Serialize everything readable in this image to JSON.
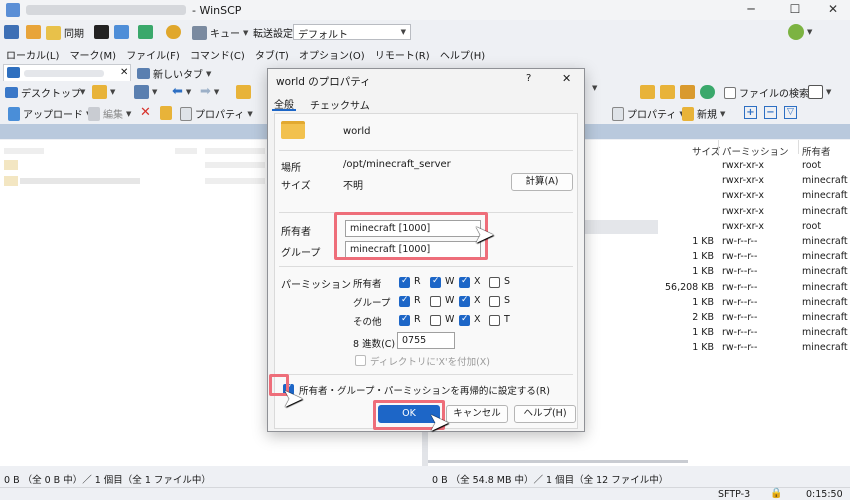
{
  "app": {
    "title": "- WinSCP",
    "window_buttons": {
      "minimize": "─",
      "maximize": "☐",
      "close": "✕"
    }
  },
  "toolbar1": {
    "sync_label": "同期",
    "queue_label": "キュー",
    "transfer_settings_label": "転送設定",
    "transfer_preset": "デフォルト"
  },
  "menu": [
    "ローカル(L)",
    "マーク(M)",
    "ファイル(F)",
    "コマンド(C)",
    "タブ(T)",
    "オプション(O)",
    "リモート(R)",
    "ヘルプ(H)"
  ],
  "tabs": {
    "new_tab": "新しいタブ"
  },
  "local_toolbar": {
    "location": "デスクトップ",
    "upload": "アップロード",
    "edit": "編集",
    "properties": "プロパティ"
  },
  "remote_toolbar": {
    "find_files": "ファイルの検索",
    "properties": "プロパティ",
    "new": "新規"
  },
  "remote_columns": {
    "size": "サイズ",
    "permissions": "パーミッション",
    "owner": "所有者"
  },
  "remote_rows": [
    {
      "size": "",
      "perm": "rwxr-xr-x",
      "owner": "root"
    },
    {
      "size": "",
      "perm": "rwxr-xr-x",
      "owner": "minecraft"
    },
    {
      "size": "",
      "perm": "rwxr-xr-x",
      "owner": "minecraft"
    },
    {
      "size": "",
      "perm": "rwxr-xr-x",
      "owner": "minecraft"
    },
    {
      "size": "",
      "perm": "rwxr-xr-x",
      "owner": "root"
    },
    {
      "size": "1 KB",
      "perm": "rw-r--r--",
      "owner": "minecraft"
    },
    {
      "size": "1 KB",
      "perm": "rw-r--r--",
      "owner": "minecraft"
    },
    {
      "size": "1 KB",
      "perm": "rw-r--r--",
      "owner": "minecraft"
    },
    {
      "size": "56,208 KB",
      "perm": "rw-r--r--",
      "owner": "minecraft"
    },
    {
      "size": "1 KB",
      "perm": "rw-r--r--",
      "owner": "minecraft"
    },
    {
      "size": "2 KB",
      "perm": "rw-r--r--",
      "owner": "minecraft"
    },
    {
      "size": "1 KB",
      "perm": "rw-r--r--",
      "owner": "minecraft"
    },
    {
      "size": "1 KB",
      "perm": "rw-r--r--",
      "owner": "minecraft"
    }
  ],
  "status": {
    "local": "0 B （全 0 B 中）／ 1 個目（全 1 ファイル中）",
    "remote": "0 B （全 54.8 MB 中）／ 1 個目（全 12 ファイル中）",
    "protocol": "SFTP-3",
    "time": "0:15:50"
  },
  "dialog": {
    "title": "world のプロパティ",
    "help": "?",
    "close": "✕",
    "tab_general": "全般",
    "tab_checksum": "チェックサム",
    "name": "world",
    "location_label": "場所",
    "location_value": "/opt/minecraft_server",
    "size_label": "サイズ",
    "size_value": "不明",
    "calc_button": "計算(A)",
    "owner_label": "所有者",
    "owner_value": "minecraft [1000]",
    "group_label": "グループ",
    "group_value": "minecraft [1000]",
    "perm_label": "パーミッション",
    "perm_rows": [
      {
        "label": "所有者",
        "r": "R",
        "w": "W",
        "x": "X",
        "s": "S"
      },
      {
        "label": "グループ",
        "r": "R",
        "w": "W",
        "x": "X",
        "s": "S"
      },
      {
        "label": "その他",
        "r": "R",
        "w": "W",
        "x": "X",
        "s": "T"
      }
    ],
    "octal_label": "8 進数(C)",
    "octal_value": "0755",
    "add_x_label": "ディレクトリに'X'を付加(X)",
    "recursive_label": "所有者・グループ・パーミッションを再帰的に設定する(R)",
    "ok": "OK",
    "cancel": "キャンセル",
    "help_button": "ヘルプ(H)"
  },
  "colors": {
    "highlight": "#ee6e7a",
    "checkbox": "#1d66c7"
  }
}
